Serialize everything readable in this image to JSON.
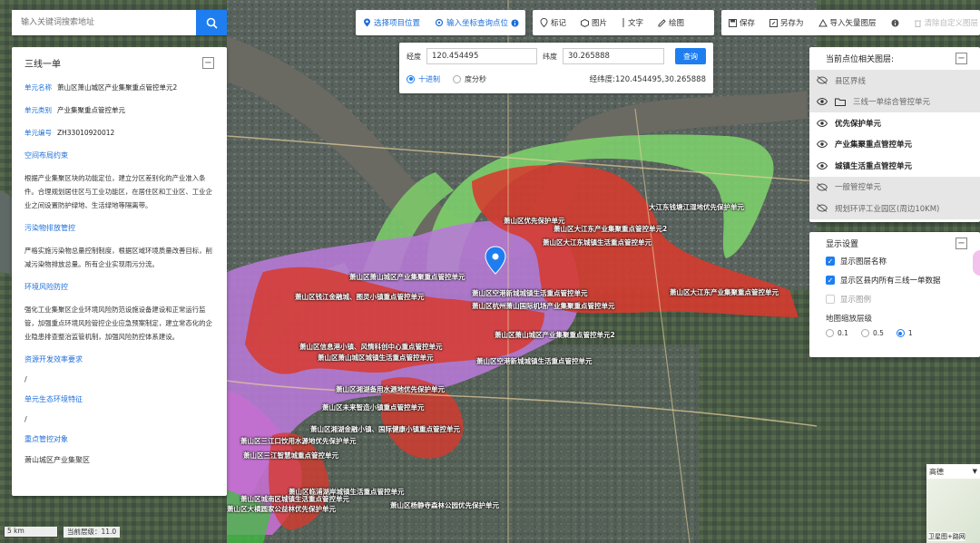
{
  "search": {
    "placeholder": "输入关键词搜索地址"
  },
  "toolbar1": {
    "select_location": "选择项目位置",
    "input_coords": "输入坐标查询点位"
  },
  "toolbar2": {
    "mark": "标记",
    "image": "图片",
    "text": "文字",
    "draw": "绘图"
  },
  "toolbar3": {
    "save": "保存",
    "save_as": "另存为",
    "import_vector": "导入矢量图层",
    "clear_custom": "清除自定义图层"
  },
  "info_panel": {
    "title": "三线一单",
    "unit_name_label": "单元名称",
    "unit_name": "萧山区萧山城区产业集聚重点管控单元2",
    "unit_type_label": "单元类别",
    "unit_type": "产业集聚重点管控单元",
    "unit_code_label": "单元编号",
    "unit_code": "ZH33010920012",
    "spatial_title": "空间布局约束",
    "spatial_text": "根据产业集聚区块的功能定位，建立分区差别化的产业准入条件。合理规划居住区与工业功能区，在居住区和工业区、工业企业之间设置防护绿地、生活绿地等隔离带。",
    "pollution_title": "污染物排放管控",
    "pollution_text": "严格实施污染物总量控制制度，根据区域环境质量改善目标，削减污染物排放总量。所有企业实现雨污分流。",
    "risk_title": "环境风险防控",
    "risk_text": "强化工业集聚区企业环境风险防范设施设备建设和正常运行监管，加强重点环境风险管控企业应急预案制定，建立常态化的企业隐患排查整治监管机制，加强风险防控体系建设。",
    "resource_title": "资源开发效率要求",
    "resource_value": "/",
    "eco_title": "单元生态环境特征",
    "eco_value": "/",
    "target_title": "重点管控对象",
    "target_value": "萧山城区产业集聚区"
  },
  "coord_panel": {
    "lng_label": "经度",
    "lng_value": "120.454495",
    "lat_label": "纬度",
    "lat_value": "30.265888",
    "query_btn": "查询",
    "decimal": "十进制",
    "dms": "度分秒",
    "result": "经纬度:120.454495,30.265888"
  },
  "layers_panel": {
    "title": "当前点位相关图层:",
    "items": [
      {
        "label": "县区界线",
        "on": false,
        "icon": "eye-off-icon"
      },
      {
        "label": "三线一单综合管控单元",
        "on": false,
        "icon": "folder-icon"
      },
      {
        "label": "优先保护单元",
        "on": true,
        "icon": "eye-icon"
      },
      {
        "label": "产业集聚重点管控单元",
        "on": true,
        "icon": "eye-icon"
      },
      {
        "label": "城镇生活重点管控单元",
        "on": true,
        "icon": "eye-icon"
      },
      {
        "label": "一般管控单元",
        "on": false,
        "icon": "eye-off-icon"
      },
      {
        "label": "规划环评工业园区(周边10KM)",
        "on": false,
        "icon": "eye-off-icon"
      }
    ]
  },
  "display_panel": {
    "title": "显示设置",
    "show_layer_names": "显示图层名称",
    "show_all_units": "显示区县内所有三线一单数据",
    "show_legend": "显示图例",
    "zoom_title": "地图缩放层级",
    "zoom_options": [
      "0.1",
      "0.5",
      "1"
    ],
    "zoom_selected": "1"
  },
  "scale": "5 km",
  "current_level": "当前层级：11.0",
  "basemap": {
    "name": "高德",
    "thumb_label": "卫星图+路网"
  },
  "map_labels": [
    "萧山区优先保护单元",
    "萧山区大江东产业集聚重点管控单元2",
    "萧山区大江东城镇生活重点管控单元",
    "大江东钱塘江湿地优先保护单元",
    "萧山区萧山城区产业集聚重点管控单元",
    "萧山区空港新城城镇生活重点管控单元",
    "萧山区大江东产业集聚重点管控单元",
    "萧山区钱江金融城、图灵小镇重点管控单元",
    "萧山区杭州萧山国际机场产业集聚重点管控单元",
    "萧山区萧山城区产业集聚重点管控单元2",
    "萧山区信息港小镇、风情科创中心重点管控单元",
    "萧山区萧山城区城镇生活重点管控单元",
    "萧山区空港新城城镇生活重点管控单元",
    "萧山区湘湖备用水源地优先保护单元",
    "萧山区未来智造小镇重点管控单元",
    "萧山区湘湖金融小镇、国际健康小镇重点管控单元",
    "萧山区三江口饮用水源地优先保护单元",
    "萧山区三江智慧城重点管控单元",
    "萧山区临浦湖岸城镇生活重点管控单元",
    "萧山区城南区城镇生活重点管控单元",
    "萧山区杨静寺森林公园优先保护单元",
    "萧山区大横圆家公益林优先保护单元"
  ]
}
